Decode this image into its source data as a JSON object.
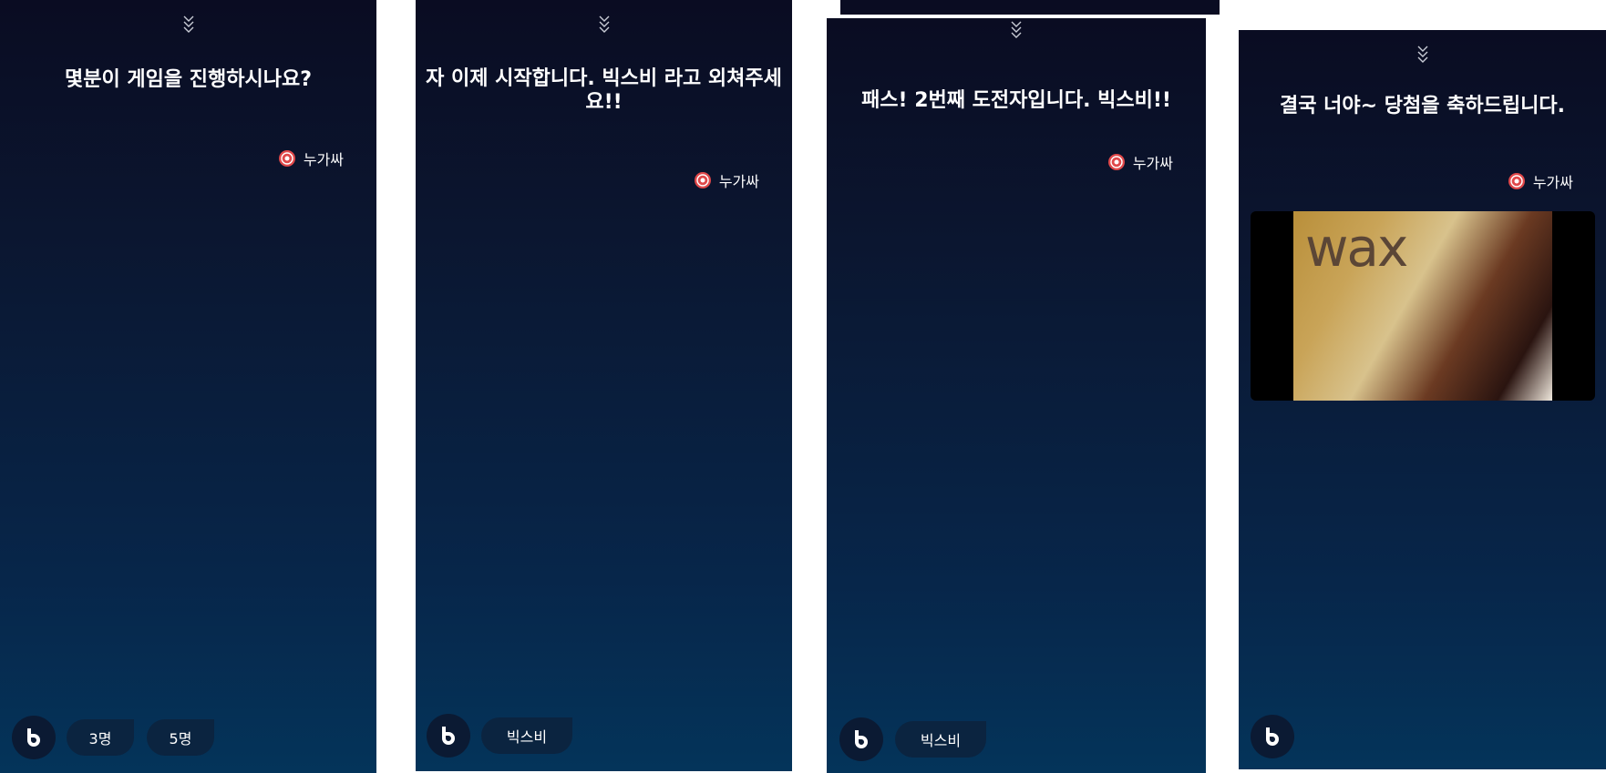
{
  "panels": [
    {
      "prompt": "몇분이 게임을 진행하시나요?",
      "source_label": "누가싸",
      "chips": [
        "3명",
        "5명"
      ]
    },
    {
      "prompt": "자 이제 시작합니다. 빅스비 라고 외쳐주세요!!",
      "source_label": "누가싸",
      "chips": [
        "빅스비"
      ]
    },
    {
      "prompt": "패스! 2번째 도전자입니다. 빅스비!!",
      "source_label": "누가싸",
      "chips": [
        "빅스비"
      ]
    },
    {
      "prompt": "결국 너야~ 당첨을 축하드립니다.",
      "source_label": "누가싸",
      "image_text": "wax",
      "chips": []
    }
  ],
  "icons": {
    "collapse": "double-chevron-down-icon",
    "source": "target-icon",
    "assistant": "bixby-icon"
  },
  "colors": {
    "panel_top": "#0a0c22",
    "panel_bottom": "#04345a",
    "chip_bg": "#0b2440",
    "source_icon": "#e0484a"
  }
}
